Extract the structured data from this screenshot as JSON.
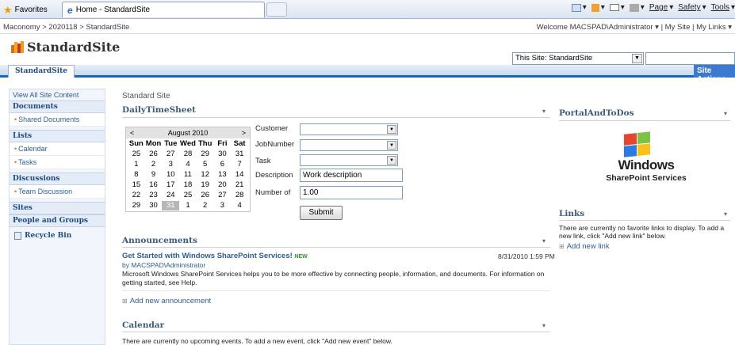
{
  "browser": {
    "favorites_label": "Favorites",
    "tab_title": "Home - StandardSite",
    "commands": {
      "page": "Page",
      "safety": "Safety",
      "tools": "Tools"
    }
  },
  "topline": {
    "breadcrumb": "Maconomy > 2020118 > StandardSite",
    "welcome": "Welcome MACSPAD\\Administrator ▾ | My Site | My Links ▾"
  },
  "site": {
    "title": "StandardSite",
    "nav_tab": "StandardSite",
    "site_actions": "Site Actions",
    "search_scope": "This Site: StandardSite",
    "search_value": ""
  },
  "quicklaunch": {
    "view_all": "View All Site Content",
    "documents_head": "Documents",
    "shared_documents": "Shared Documents",
    "lists_head": "Lists",
    "calendar": "Calendar",
    "tasks": "Tasks",
    "discussions_head": "Discussions",
    "team_discussion": "Team Discussion",
    "sites_head": "Sites",
    "people_head": "People and Groups",
    "recycle_bin": "Recycle Bin"
  },
  "page_label": "Standard Site",
  "timesheet": {
    "title": "DailyTimeSheet",
    "calendar": {
      "prev": "<",
      "month": "August 2010",
      "next": ">",
      "days_of_week": [
        "Sun",
        "Mon",
        "Tue",
        "Wed",
        "Thu",
        "Fri",
        "Sat"
      ],
      "weeks": [
        [
          "25",
          "26",
          "27",
          "28",
          "29",
          "30",
          "31"
        ],
        [
          "1",
          "2",
          "3",
          "4",
          "5",
          "6",
          "7"
        ],
        [
          "8",
          "9",
          "10",
          "11",
          "12",
          "13",
          "14"
        ],
        [
          "15",
          "16",
          "17",
          "18",
          "19",
          "20",
          "21"
        ],
        [
          "22",
          "23",
          "24",
          "25",
          "26",
          "27",
          "28"
        ],
        [
          "29",
          "30",
          "31",
          "1",
          "2",
          "3",
          "4"
        ]
      ],
      "selected_day": "31"
    },
    "form": {
      "customer_label": "Customer",
      "jobnumber_label": "JobNumber",
      "task_label": "Task",
      "description_label": "Description",
      "description_value": "Work description",
      "number_label": "Number of",
      "number_value": "1.00",
      "submit_label": "Submit"
    }
  },
  "announcements": {
    "title": "Announcements",
    "item_title": "Get Started with Windows SharePoint Services!",
    "new_badge": "NEW",
    "item_date": "8/31/2010 1:59 PM",
    "item_by": "by MACSPAD\\Administrator",
    "item_body": "Microsoft Windows SharePoint Services helps you to be more effective by connecting people, information, and documents. For information on getting started, see Help.",
    "add_link": "Add new announcement"
  },
  "calendar_part": {
    "title": "Calendar",
    "empty_text": "There are currently no upcoming events. To add a new event, click \"Add new event\" below."
  },
  "portal": {
    "title": "PortalAndToDos",
    "logo_text": "Windows",
    "logo_sub": "SharePoint Services"
  },
  "links_part": {
    "title": "Links",
    "empty_text": "There are currently no favorite links to display. To add a new link, click \"Add new link\" below.",
    "add_link": "Add new link"
  },
  "colors": {
    "accent": "#1e65b0",
    "link": "#2b5d9a",
    "webpart_title": "#3c5b7c"
  },
  "icons": [
    "star-icon",
    "ie-icon",
    "home-icon",
    "rss-icon",
    "mail-icon",
    "print-icon",
    "site-logo-icon",
    "dropdown-icon",
    "recycle-bin-icon",
    "windows-flag-icon",
    "add-icon"
  ]
}
